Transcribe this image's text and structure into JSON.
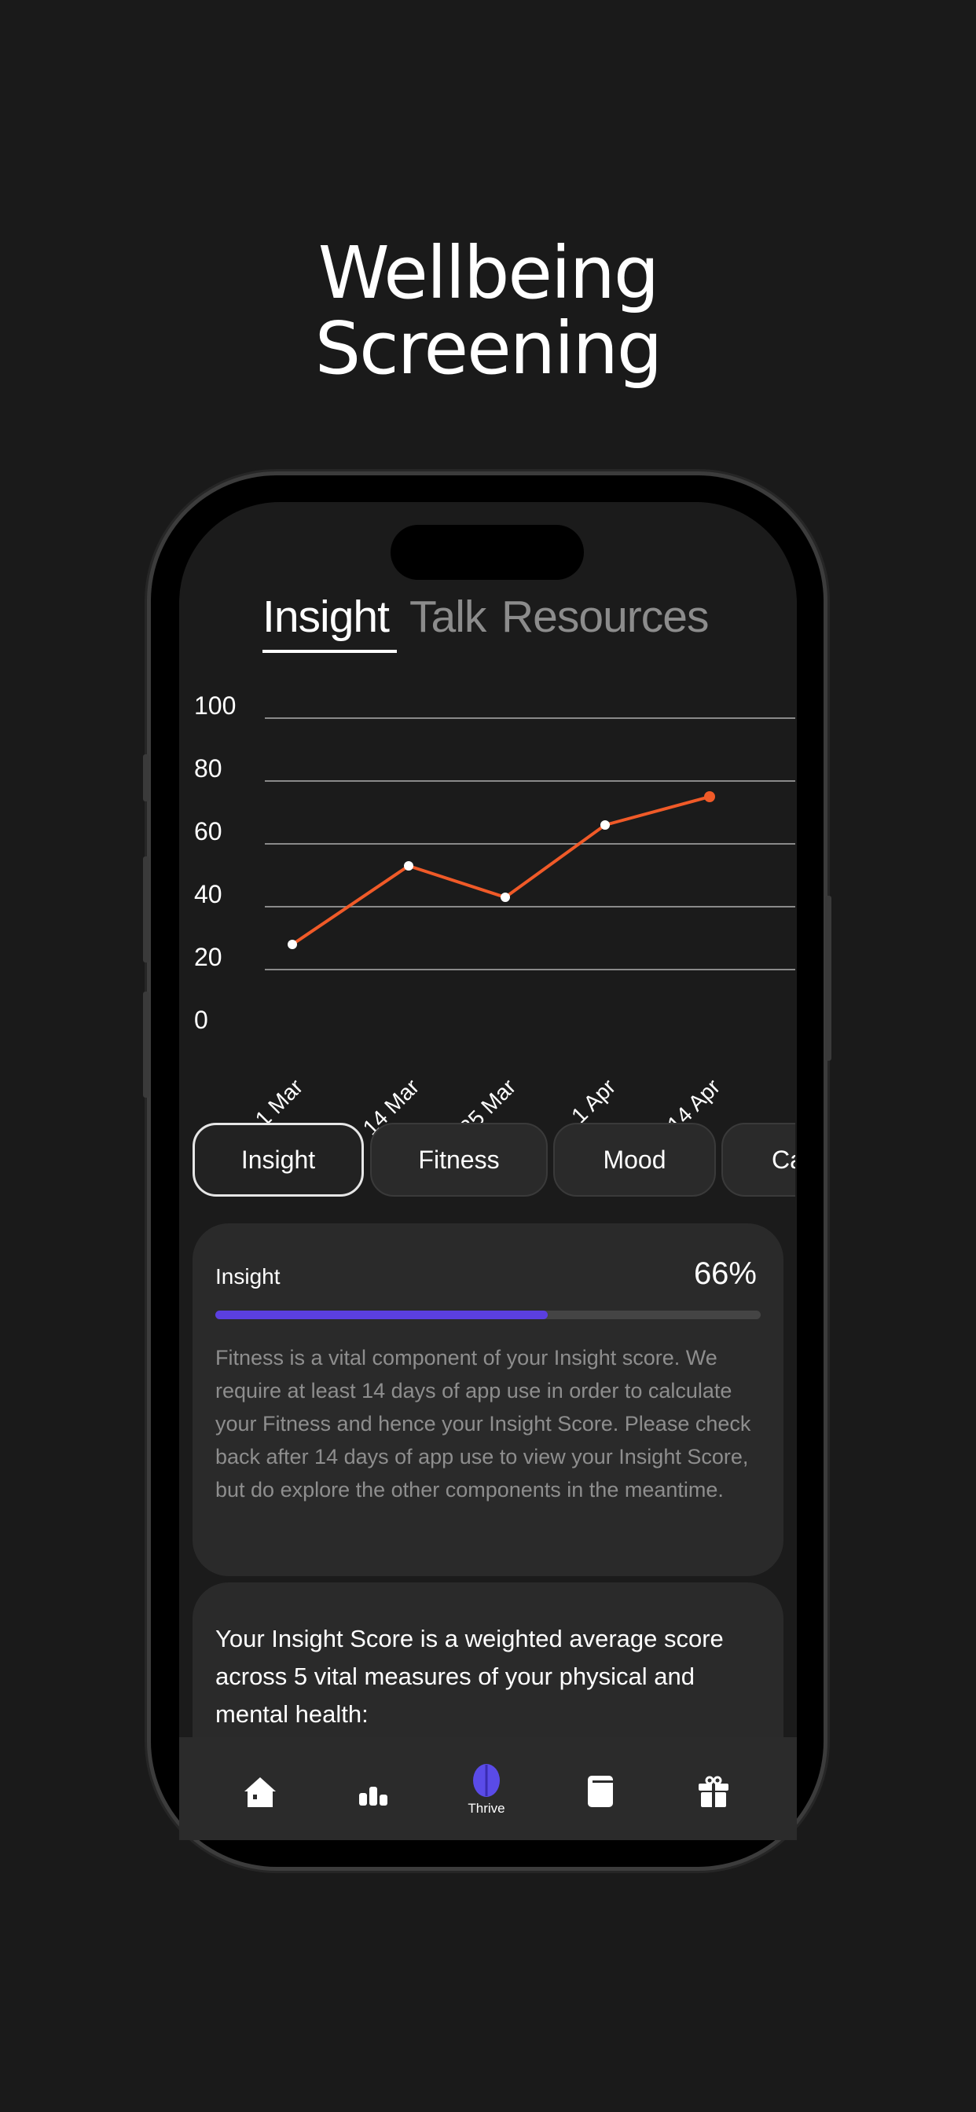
{
  "headline": {
    "line1": "Wellbeing",
    "line2": "Screening"
  },
  "top_tabs": [
    {
      "label": "Insight",
      "active": true
    },
    {
      "label": "Talk",
      "active": false
    },
    {
      "label": "Resources",
      "active": false
    }
  ],
  "chart_data": {
    "type": "line",
    "categories": [
      "1 Mar",
      "14 Mar",
      "25 Mar",
      "1 Apr",
      "14 Apr"
    ],
    "values": [
      28,
      53,
      43,
      66,
      75
    ],
    "y_ticks": [
      "100",
      "80",
      "60",
      "40",
      "20",
      "0"
    ],
    "ylim": [
      0,
      100
    ],
    "grid": true,
    "line_color": "#f05a28",
    "point_color": "#ffffff",
    "last_point_color": "#f05a28"
  },
  "filter_pills": [
    {
      "label": "Insight",
      "active": true
    },
    {
      "label": "Fitness",
      "active": false
    },
    {
      "label": "Mood",
      "active": false
    },
    {
      "label": "Ca",
      "active": false
    }
  ],
  "score_card": {
    "label": "Insight",
    "value_text": "66%",
    "progress_fill_percent": 61,
    "progress_color": "#5b3fe0",
    "description": "Fitness is a vital component of your Insight score. We require at least 14 days of app use in order to calculate your Fitness and hence your Insight Score. Please check back after 14 days of app use to view your Insight Score, but do explore the other components in the meantime."
  },
  "info_card": {
    "text": "Your Insight Score is a weighted average score across 5 vital measures of your physical and mental health:"
  },
  "bottom_nav": {
    "items": [
      {
        "icon": "home-icon"
      },
      {
        "icon": "bar-chart-icon"
      },
      {
        "icon": "brain-icon",
        "label": "Thrive",
        "active": true
      },
      {
        "icon": "book-icon"
      },
      {
        "icon": "gift-icon"
      }
    ]
  }
}
